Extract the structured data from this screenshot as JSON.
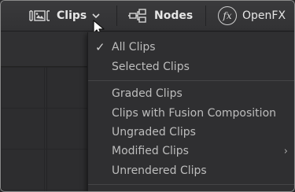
{
  "toolbar": {
    "clips_label": "Clips",
    "nodes_label": "Nodes",
    "openfx_label": "OpenFX",
    "openfx_badge": "fx"
  },
  "menu": {
    "items": [
      {
        "label": "All Clips",
        "checked": true
      },
      {
        "label": "Selected Clips"
      },
      {
        "label": "Graded Clips"
      },
      {
        "label": "Clips with Fusion Composition"
      },
      {
        "label": "Ungraded Clips"
      },
      {
        "label": "Modified Clips",
        "submenu": true
      },
      {
        "label": "Unrendered Clips"
      }
    ],
    "check_glyph": "✓",
    "submenu_glyph": "›"
  },
  "colors": {
    "toolbar_bg": "#363638",
    "menu_bg": "#2f2f31",
    "text": "#bdbdbd"
  }
}
